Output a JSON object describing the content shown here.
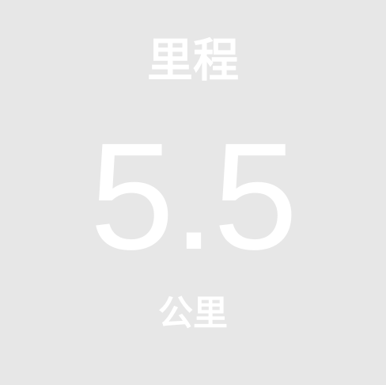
{
  "metric": {
    "title": "里程",
    "value": "5.5",
    "unit": "公里"
  },
  "colors": {
    "background": "#e7e7e7",
    "text": "#ffffff"
  }
}
